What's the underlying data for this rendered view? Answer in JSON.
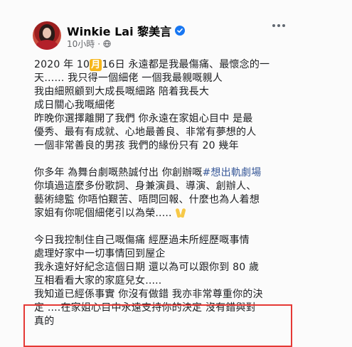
{
  "post": {
    "author_name": "Winkie Lai 黎美言",
    "time": "10小時",
    "separator": "·",
    "verified": true
  },
  "icons": {
    "verified_badge": "verified-check-icon",
    "privacy": "globe-icon",
    "menu": "more-horizontal-icon",
    "emoji": "raising-hands-emoji"
  },
  "content": {
    "l1_pre": "2020 年 10",
    "l1_month": "月",
    "l1_post": "16日 永遠都是我最傷痛、最懷念的一",
    "l2": "天…… 我只得一個細佬 一個我最親嘅親人",
    "l3": "我由細照顧到大成長嘅細路 陪着我長大",
    "l4": "成日關心我嘅細佬",
    "l5": "昨晚你選擇離開了我們 你永遠在家姐心目中 是最",
    "l6": "優秀、最有有成就、心地最善良、非常有夢想的人",
    "l7": "一個非常善良的男孩 我們的緣份只有 20 幾年",
    "l8_pre": "你多年 為舞台劇嘅熱誠付出 你創辦嘅",
    "l8_tag": "#想出軌劇場",
    "l9": "你填過這麼多份歌詞、身兼演員、導演、創辦人、",
    "l10": "藝術總監 你唔怕艱苦、唔問回報、什麼也為人着想",
    "l11": "家姐有你呢個細佬引以為榮.....",
    "l12": "今日我控制住自己嘅傷痛 經歷過未所經歷嘅事情",
    "l13": "處理好家中一切事情回到屋企",
    "l14": "我永遠好好紀念這個日期 還以為可以跟你到 80 歲",
    "l15": "互相看看大家的家庭兒女.....",
    "l16": "我知道已經係事實 你沒有做錯 我亦非常尊重你的決",
    "l17": "定 ....在家姐心目中永遠支持你的決定 沒有錯與對",
    "l18": "真的"
  },
  "colors": {
    "name": "#050505",
    "meta": "#65676b",
    "hashtag": "#385898",
    "date_highlight": "#f6b61b",
    "verified": "#1877f2",
    "highlight_box": "#e53935"
  }
}
